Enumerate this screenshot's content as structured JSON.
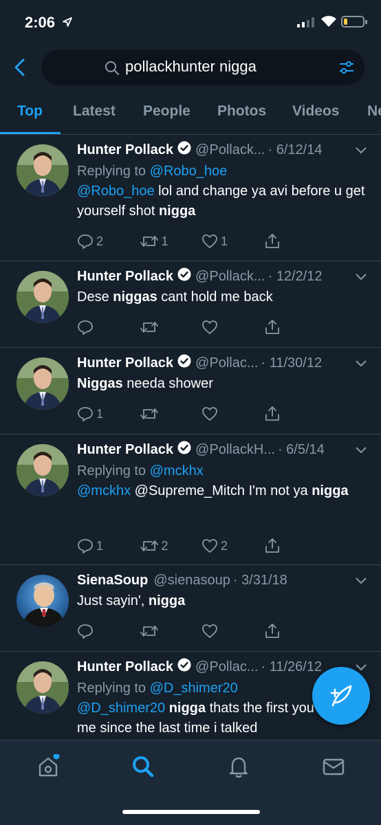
{
  "status_bar": {
    "time": "2:06"
  },
  "search": {
    "query": "pollackhunter nigga"
  },
  "tabs": [
    {
      "label": "Top"
    },
    {
      "label": "Latest"
    },
    {
      "label": "People"
    },
    {
      "label": "Photos"
    },
    {
      "label": "Videos"
    },
    {
      "label": "Ne"
    }
  ],
  "tweets": [
    {
      "name": "Hunter Pollack",
      "handle": "@Pollack...",
      "date": "· 6/12/14",
      "replying_prefix": "Replying to",
      "replying_to": "@Robo_hoe",
      "mention": "@Robo_hoe",
      "text_a": " lol and change ya avi before u get yourself shot ",
      "bold_a": "nigga",
      "replies": "2",
      "retweets": "1",
      "likes": "1"
    },
    {
      "name": "Hunter Pollack",
      "handle": "@Pollack...",
      "date": "· 12/2/12",
      "text_a": "Dese ",
      "bold_a": "niggas",
      "text_b": " cant hold me back"
    },
    {
      "name": "Hunter Pollack",
      "handle": "@Pollac...",
      "date": "· 11/30/12",
      "bold_a": "Niggas",
      "text_b": " needa shower",
      "replies": "1"
    },
    {
      "name": "Hunter Pollack",
      "handle": "@PollackH...",
      "date": "· 6/5/14",
      "replying_prefix": "Replying to",
      "replying_to": "@mckhx",
      "mention": "@mckhx",
      "text_a": " @Supreme_Mitch I'm not ya ",
      "bold_a": "nigga",
      "replies": "1",
      "retweets": "2",
      "likes": "2"
    },
    {
      "name": "SienaSoup",
      "handle": "@sienasoup",
      "date": "· 3/31/18",
      "text_a": "Just sayin', ",
      "bold_a": "nigga"
    },
    {
      "name": "Hunter Pollack",
      "handle": "@Pollac...",
      "date": "· 11/26/12",
      "replying_prefix": "Replying to",
      "replying_to": "@D_shimer20",
      "mention": "@D_shimer20",
      "bold_a": "nigga",
      "text_b": " thats the first you say to me since the last time i talked"
    }
  ],
  "colors": {
    "background": "#15202b",
    "accent": "#1da1f2",
    "secondary_text": "#8899a6",
    "divider": "#38444d"
  },
  "icons": {
    "nav": [
      "home-icon",
      "search-icon",
      "notifications-bell-icon",
      "messages-mail-icon"
    ]
  }
}
